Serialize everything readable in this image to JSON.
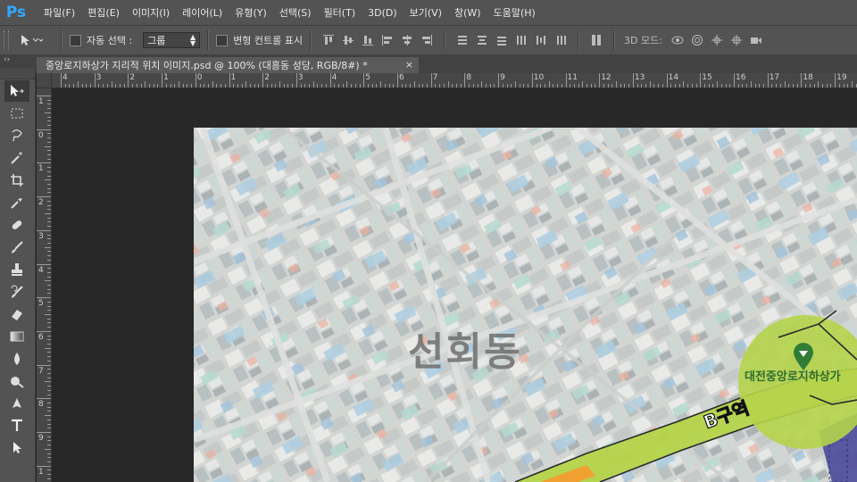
{
  "app": {
    "logo": "Ps"
  },
  "menu": [
    "파일(F)",
    "편집(E)",
    "이미지(I)",
    "레이어(L)",
    "유형(Y)",
    "선택(S)",
    "필터(T)",
    "3D(D)",
    "보기(V)",
    "창(W)",
    "도움말(H)"
  ],
  "options": {
    "auto_select_label": "자동 선택 :",
    "auto_select_value": "그룹",
    "transform_label": "변형 컨트롤 표시",
    "three_d_label": "3D 모드:"
  },
  "document": {
    "tab_title": "중앙로지하상가 지리적 위치 이미지.psd @ 100% (대흥동 성당, RGB/8#) *",
    "close_glyph": "×"
  },
  "rulers": {
    "horizontal": [
      "4",
      "3",
      "2",
      "1",
      "0",
      "1",
      "2",
      "3",
      "4",
      "5",
      "6",
      "7",
      "8",
      "9",
      "10",
      "11",
      "12",
      "13",
      "14",
      "15",
      "16",
      "17",
      "18",
      "19"
    ],
    "vertical": [
      "1",
      "0",
      "1",
      "2",
      "3",
      "4",
      "5",
      "6",
      "7",
      "8",
      "9",
      "1"
    ]
  },
  "canvas": {
    "district_label": "선회동",
    "zone_label": "B구역",
    "station_label": "대전중앙로지하상가",
    "colors": {
      "green_zone": "#b5d44a",
      "pin": "#2f7d36",
      "orange_zone": "#f0a030",
      "blue_zone": "#4a4a9a"
    }
  },
  "tools": [
    "move-tool",
    "marquee-tool",
    "lasso-tool",
    "magic-wand-tool",
    "crop-tool",
    "eyedropper-tool",
    "healing-brush-tool",
    "brush-tool",
    "clone-stamp-tool",
    "history-brush-tool",
    "eraser-tool",
    "gradient-tool",
    "blur-tool",
    "dodge-tool",
    "pen-tool",
    "type-tool",
    "path-selection-tool"
  ]
}
